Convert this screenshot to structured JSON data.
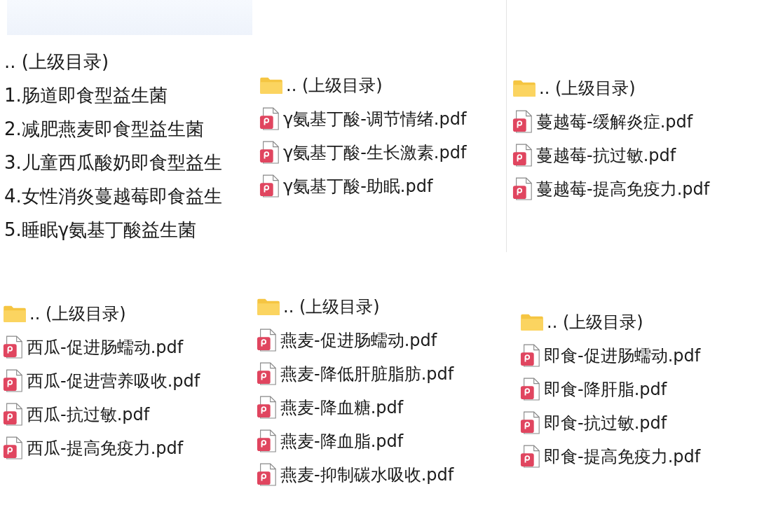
{
  "panels": [
    {
      "header_band": true,
      "items": [
        {
          "kind": "plain",
          "name": ".. (上级目录)"
        },
        {
          "kind": "plain",
          "name": "1.肠道即食型益生菌"
        },
        {
          "kind": "plain",
          "name": "2.减肥燕麦即食型益生菌"
        },
        {
          "kind": "plain",
          "name": "3.儿童西瓜酸奶即食型益生"
        },
        {
          "kind": "plain",
          "name": "4.女性消炎蔓越莓即食益生"
        },
        {
          "kind": "plain",
          "name": "5.睡眠γ氨基丁酸益生菌"
        }
      ]
    },
    {
      "items": [
        {
          "kind": "parent",
          "name": ".. (上级目录)"
        },
        {
          "kind": "pdf",
          "name": "γ氨基丁酸-调节情绪.pdf"
        },
        {
          "kind": "pdf",
          "name": "γ氨基丁酸-生长激素.pdf"
        },
        {
          "kind": "pdf",
          "name": "γ氨基丁酸-助眠.pdf"
        }
      ]
    },
    {
      "items": [
        {
          "kind": "parent",
          "name": ".. (上级目录)"
        },
        {
          "kind": "pdf",
          "name": "蔓越莓-缓解炎症.pdf"
        },
        {
          "kind": "pdf",
          "name": "蔓越莓-抗过敏.pdf"
        },
        {
          "kind": "pdf",
          "name": "蔓越莓-提高免疫力.pdf"
        }
      ]
    },
    {
      "items": [
        {
          "kind": "parent",
          "name": ".. (上级目录)"
        },
        {
          "kind": "pdf",
          "name": "西瓜-促进肠蠕动.pdf"
        },
        {
          "kind": "pdf",
          "name": "西瓜-促进营养吸收.pdf"
        },
        {
          "kind": "pdf",
          "name": "西瓜-抗过敏.pdf"
        },
        {
          "kind": "pdf",
          "name": "西瓜-提高免疫力.pdf"
        }
      ]
    },
    {
      "items": [
        {
          "kind": "parent",
          "name": ".. (上级目录)"
        },
        {
          "kind": "pdf",
          "name": "燕麦-促进肠蠕动.pdf"
        },
        {
          "kind": "pdf",
          "name": "燕麦-降低肝脏脂肪.pdf"
        },
        {
          "kind": "pdf",
          "name": "燕麦-降血糖.pdf"
        },
        {
          "kind": "pdf",
          "name": "燕麦-降血脂.pdf"
        },
        {
          "kind": "pdf",
          "name": "燕麦-抑制碳水吸收.pdf"
        }
      ]
    },
    {
      "items": [
        {
          "kind": "parent",
          "name": ".. (上级目录)"
        },
        {
          "kind": "pdf",
          "name": "即食-促进肠蠕动.pdf"
        },
        {
          "kind": "pdf",
          "name": "即食-降肝脂.pdf"
        },
        {
          "kind": "pdf",
          "name": "即食-抗过敏.pdf"
        },
        {
          "kind": "pdf",
          "name": "即食-提高免疫力.pdf"
        }
      ]
    }
  ]
}
